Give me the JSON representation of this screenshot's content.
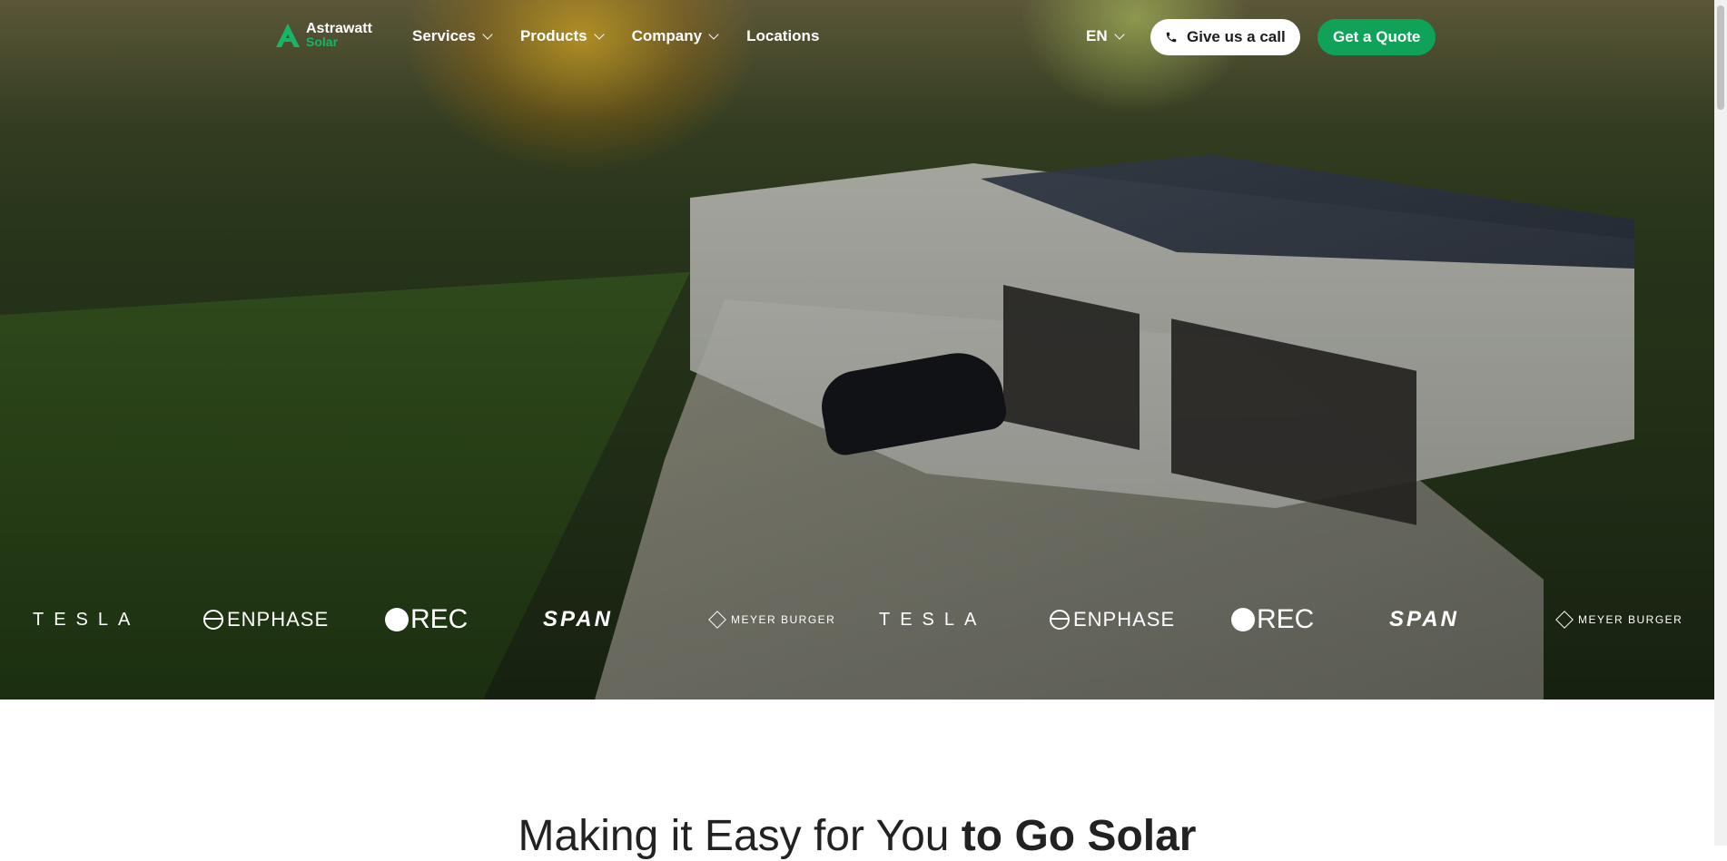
{
  "logo": {
    "name": "Astrawatt",
    "sub": "Solar"
  },
  "nav": {
    "items": [
      {
        "label": "Services",
        "has_dropdown": true
      },
      {
        "label": "Products",
        "has_dropdown": true
      },
      {
        "label": "Company",
        "has_dropdown": true
      },
      {
        "label": "Locations",
        "has_dropdown": false
      }
    ],
    "language": "EN",
    "call_label": "Give us a call",
    "quote_label": "Get a Quote"
  },
  "brands": [
    "TESLA",
    "ENPHASE",
    "REC",
    "SPAN",
    "MEYER BURGER",
    "TESLA",
    "ENPHASE",
    "REC",
    "SPAN",
    "MEYER BURGER"
  ],
  "heading": {
    "light": "Making it Easy for You ",
    "bold": "to Go Solar"
  },
  "colors": {
    "accent": "#11a25a",
    "logo_green": "#18b46a"
  }
}
